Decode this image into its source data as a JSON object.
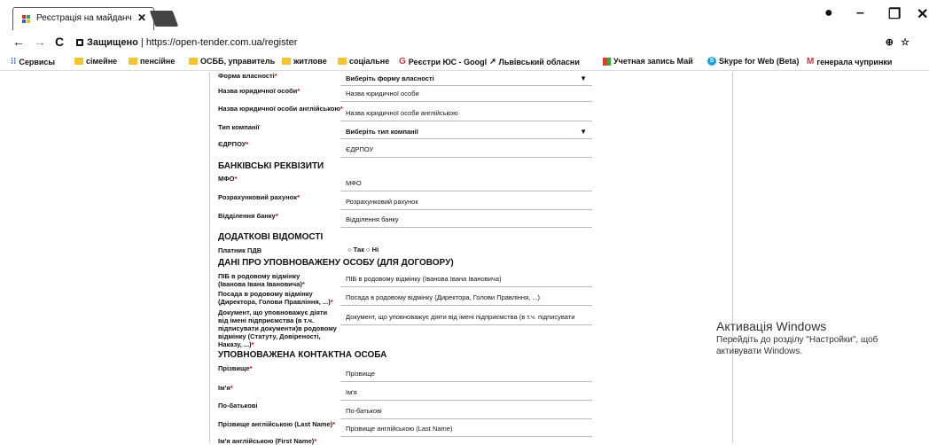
{
  "browser": {
    "tab_title": "Реєстрація на майданч",
    "tab_close": "✕",
    "url_secure": "Защищено",
    "url": "https://open-tender.com.ua/register",
    "window": {
      "minimize": "–",
      "restore": "❐",
      "close": "✕"
    }
  },
  "bookmarks": [
    {
      "icon": "apps-icon",
      "label": "Сервисы"
    },
    {
      "icon": "folder-icon",
      "label": "сімейне"
    },
    {
      "icon": "folder-icon",
      "label": "пенсійне"
    },
    {
      "icon": "folder-icon",
      "label": "ОСББ, управитель"
    },
    {
      "icon": "folder-icon",
      "label": "житлове"
    },
    {
      "icon": "folder-icon",
      "label": "соціальне"
    },
    {
      "icon": "google-icon",
      "label": "Реєстри ЮС - Googl"
    },
    {
      "icon": "link-icon",
      "label": "Львівський обласни"
    },
    {
      "icon": "ms-icon",
      "label": "Учетная запись Май"
    },
    {
      "icon": "skype-icon",
      "label": "Skype for Web (Beta)"
    },
    {
      "icon": "gmail-icon",
      "label": "генерала чупринки"
    }
  ],
  "form": {
    "ownership": {
      "label": "Форма власності",
      "value": "Виберіть форму власності"
    },
    "legal_name": {
      "label": "Назва юридичної особи",
      "placeholder": "Назва юридичної особи"
    },
    "legal_name_en": {
      "label": "Назва юридичної особи англійською",
      "placeholder": "Назва юридичної особи англійською"
    },
    "company_type": {
      "label": "Тип компанії",
      "value": "Виберіть тип компанії"
    },
    "edrpou": {
      "label": "ЄДРПОУ",
      "placeholder": "ЄДРПОУ"
    },
    "bank_section": "БАНКІВСЬКІ РЕКВІЗИТИ",
    "mfo": {
      "label": "МФО",
      "placeholder": "МФО"
    },
    "account": {
      "label": "Розрахунковий рахунок",
      "placeholder": "Розрахунковий рахунок"
    },
    "bank_branch": {
      "label": "Відділення банку",
      "placeholder": "Відділення банку"
    },
    "extra_section": "ДОДАТКОВІ ВІДОМОСТІ",
    "vat": {
      "label": "Платник ПДВ",
      "yes": "Так",
      "no": "Ні"
    },
    "agent_section": "ДАНІ ПРО УПОВНОВАЖЕНУ ОСОБУ (ДЛЯ ДОГОВОРУ)",
    "agent_name": {
      "label": "ПІБ в родовому відмінку (Іванова Івана Івановича)",
      "placeholder": "ПІБ в родовому відмінку (Іванова Івана Івановича)"
    },
    "agent_position": {
      "label": "Посада в родовому відмінку (Директора, Голови Правління, ...)",
      "placeholder": "Посада в родовому відмінку (Директора, Голови Правління, ...)"
    },
    "agent_doc": {
      "label": "Документ, що уповноважує діяти від імені підприємства (в т.ч. підписувати документи)в родовому відмінку (Статуту, Довіреності, Наказу, ...)",
      "placeholder": "Документ, що уповноважує діяти від імені підприємства (в т.ч. підписувати"
    },
    "contact_section": "УПОВНОВАЖЕНА КОНТАКТНА ОСОБА",
    "surname": {
      "label": "Прізвище",
      "placeholder": "Прізвище"
    },
    "name": {
      "label": "Ім'я",
      "placeholder": "Ім'я"
    },
    "patronymic": {
      "label": "По-батькові",
      "placeholder": "По-батькові"
    },
    "surname_en": {
      "label": "Прізвище англійською (Last Name)",
      "placeholder": "Прізвище англійською (Last Name)"
    },
    "name_en": {
      "label": "Ім'я англійською (First Name)"
    }
  },
  "activation": {
    "title": "Активація Windows",
    "line1": "Перейдіть до розділу \"Настройки\", щоб",
    "line2": "активувати Windows."
  }
}
